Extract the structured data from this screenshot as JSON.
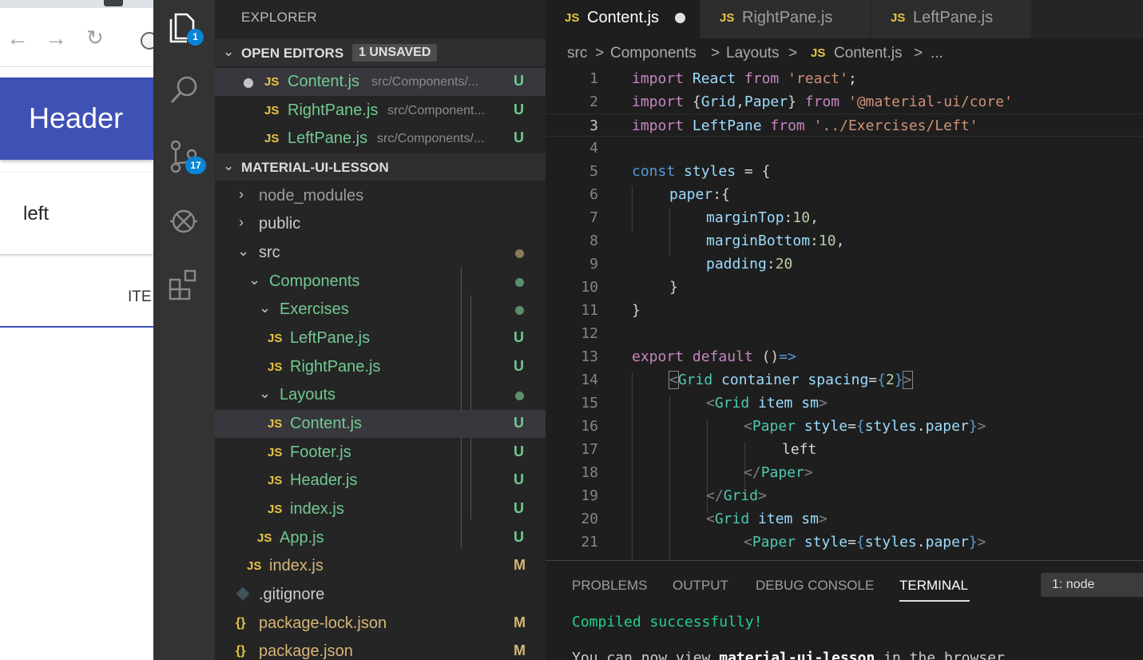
{
  "browser": {
    "nav": {
      "back": "←",
      "forward": "→",
      "reload": "↻"
    },
    "app": {
      "header_title": "Header",
      "paper_text": "left",
      "tab_text": "ITE"
    }
  },
  "activity_bar": {
    "explorer_badge": "1",
    "scm_badge": "17"
  },
  "explorer": {
    "title": "EXPLORER",
    "open_editors": {
      "title": "OPEN EDITORS",
      "badge": "1 UNSAVED",
      "items": [
        {
          "name": "Content.js",
          "path": "src/Components/...",
          "status": "U"
        },
        {
          "name": "RightPane.js",
          "path": "src/Component...",
          "status": "U"
        },
        {
          "name": "LeftPane.js",
          "path": "src/Components/...",
          "status": "U"
        }
      ]
    },
    "project": {
      "title": "MATERIAL-UI-LESSON",
      "items": [
        {
          "name": "node_modules"
        },
        {
          "name": "public"
        },
        {
          "name": "src"
        },
        {
          "name": "Components"
        },
        {
          "name": "Exercises"
        },
        {
          "name": "LeftPane.js",
          "status": "U"
        },
        {
          "name": "RightPane.js",
          "status": "U"
        },
        {
          "name": "Layouts"
        },
        {
          "name": "Content.js",
          "status": "U"
        },
        {
          "name": "Footer.js",
          "status": "U"
        },
        {
          "name": "Header.js",
          "status": "U"
        },
        {
          "name": "index.js",
          "status": "U"
        },
        {
          "name": "App.js",
          "status": "U"
        },
        {
          "name": "index.js",
          "status": "M"
        },
        {
          "name": ".gitignore"
        },
        {
          "name": "package-lock.json",
          "status": "M"
        },
        {
          "name": "package.json",
          "status": "M"
        }
      ]
    }
  },
  "editor": {
    "tabs": [
      {
        "icon": "JS",
        "name": "Content.js"
      },
      {
        "icon": "JS",
        "name": "RightPane.js"
      },
      {
        "icon": "JS",
        "name": "LeftPane.js"
      }
    ],
    "breadcrumb": [
      "src",
      ">",
      "Components",
      ">",
      "Layouts",
      ">",
      "JS",
      "Content.js",
      ">",
      "..."
    ],
    "line_numbers": [
      "1",
      "2",
      "3",
      "4",
      "5",
      "6",
      "7",
      "8",
      "9",
      "10",
      "11",
      "12",
      "13",
      "14",
      "15",
      "16",
      "17",
      "18",
      "19",
      "20",
      "21"
    ]
  },
  "panel": {
    "tabs": [
      "PROBLEMS",
      "OUTPUT",
      "DEBUG CONSOLE",
      "TERMINAL"
    ],
    "terminal_selector": "1: node",
    "line1": "Compiled successfully!",
    "line2_prefix": "You can now view ",
    "line2_bold": "material-ui-lesson",
    "line2_suffix": " in the browser."
  },
  "colors": {
    "accent_blue": "#3f51b5",
    "badge_blue": "#0a84d6",
    "untracked_green": "#73c991",
    "modified_brown": "#d6b676",
    "js_yellow": "#e8c441"
  }
}
